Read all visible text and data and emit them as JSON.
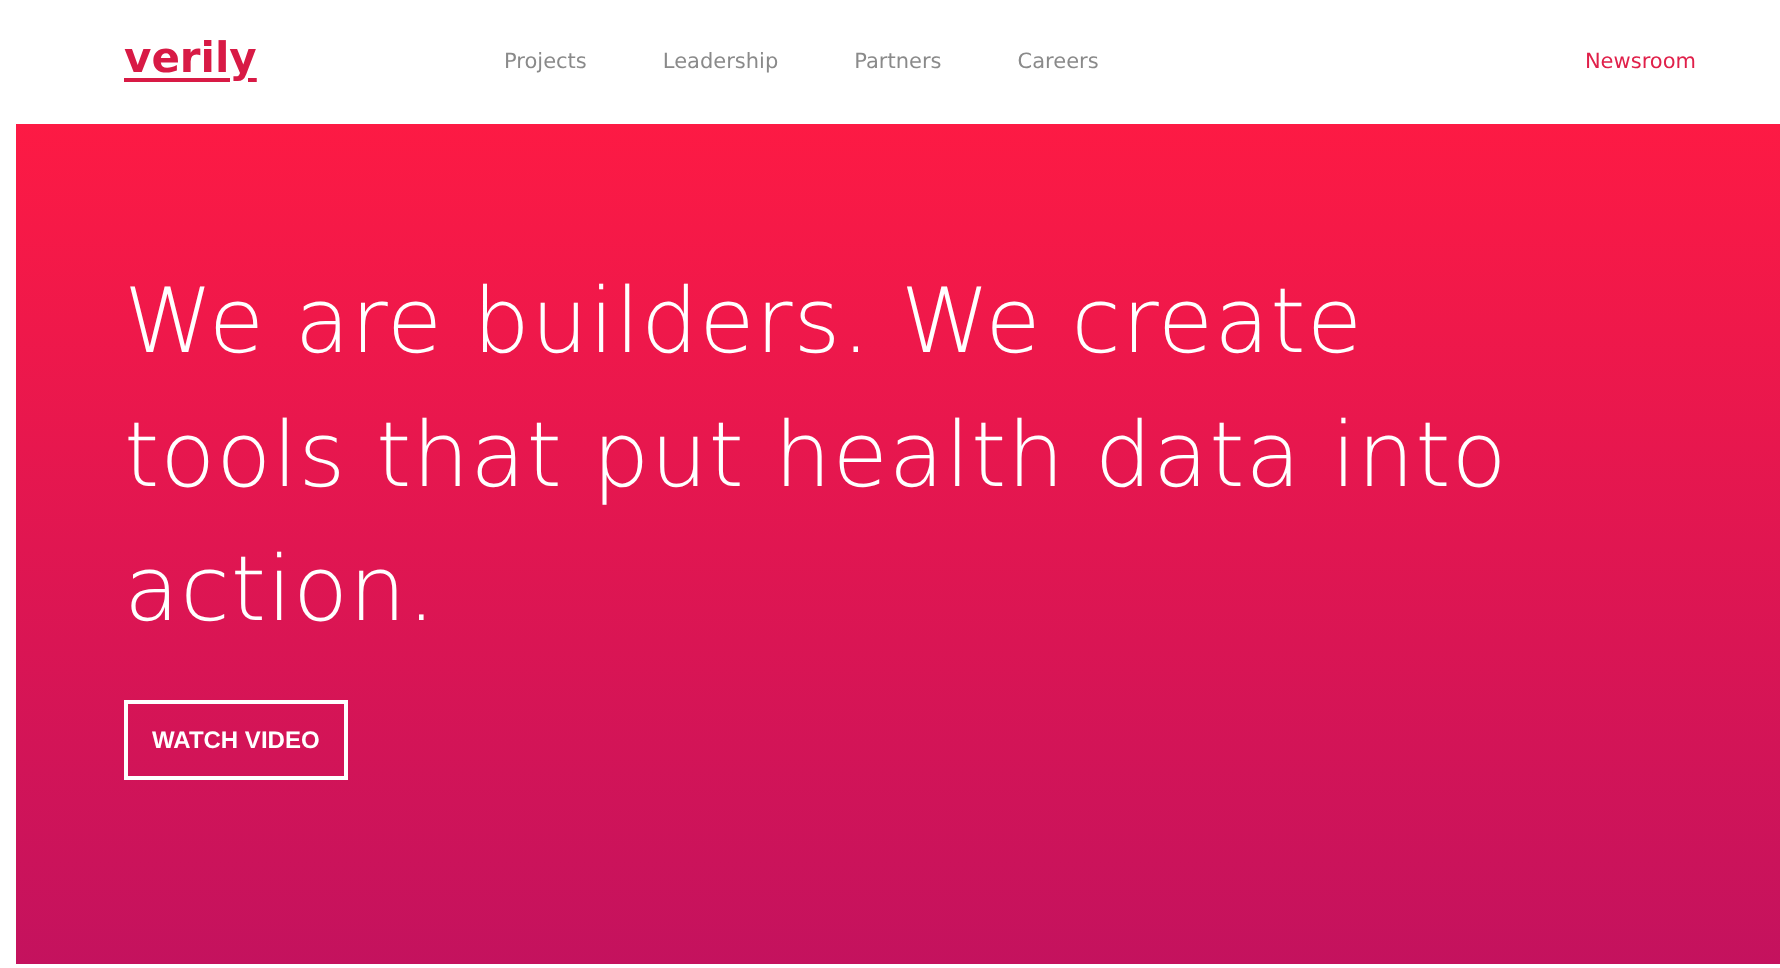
{
  "logo": "verily",
  "nav": [
    {
      "label": "Projects",
      "highlighted": false
    },
    {
      "label": "Leadership",
      "highlighted": false
    },
    {
      "label": "Partners",
      "highlighted": false
    },
    {
      "label": "Careers",
      "highlighted": false
    }
  ],
  "newsroom": {
    "label": "Newsroom",
    "highlighted": true
  },
  "hero": {
    "headline": "We are builders. We create tools that put health data into action.",
    "button": "WATCH VIDEO"
  }
}
